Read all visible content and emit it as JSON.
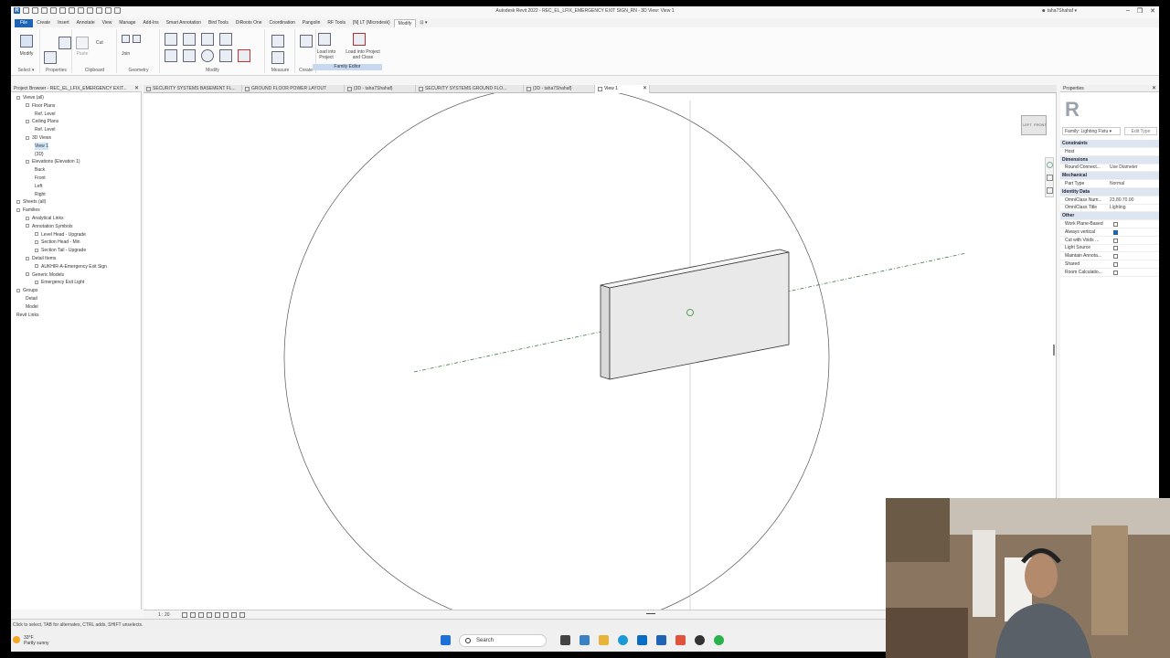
{
  "app": {
    "window_title": "Autodesk Revit 2022 - REC_EL_LFIX_EMERGENCY EXIT SIGN_RN - 3D View: View 1",
    "user": "taha7Shahaf",
    "quick_access_logo": "R"
  },
  "menu": {
    "tabs": [
      "File",
      "Create",
      "Insert",
      "Annotate",
      "View",
      "Manage",
      "Add-Ins",
      "Smart Annotation",
      "Bird Tools",
      "DiRoots One",
      "Coordination",
      "Pangolin",
      "RF Tools",
      "[N] LT (Microdesk)",
      "Modify",
      "⊡ ▾"
    ],
    "active": "Modify"
  },
  "ribbon": {
    "modify_label": "Modify",
    "select_label": "Select ▾",
    "properties_label": "Properties",
    "clipboard": {
      "label": "Clipboard",
      "paste": "Paste",
      "cut": "Cut",
      "join": "Join"
    },
    "geometry_label": "Geometry",
    "modify_group_label": "Modify",
    "measure_label": "Measure",
    "create_label": "Create",
    "load_into_project": "Load into Project",
    "load_into_project_close": "Load into Project and Close",
    "family_editor_label": "Family Editor"
  },
  "project_browser": {
    "title": "Project Browser - REC_EL_LFIX_EMERGENCY EXIT...",
    "items": [
      {
        "label": "Views (all)",
        "indent": 0,
        "toggle": true
      },
      {
        "label": "Floor Plans",
        "indent": 1,
        "toggle": true
      },
      {
        "label": "Ref. Level",
        "indent": 2,
        "toggle": false
      },
      {
        "label": "Ceiling Plans",
        "indent": 1,
        "toggle": true
      },
      {
        "label": "Ref. Level",
        "indent": 2,
        "toggle": false
      },
      {
        "label": "3D Views",
        "indent": 1,
        "toggle": true
      },
      {
        "label": "View 1",
        "indent": 2,
        "toggle": false,
        "selected": true
      },
      {
        "label": "{3D}",
        "indent": 2,
        "toggle": false
      },
      {
        "label": "Elevations (Elevation 1)",
        "indent": 1,
        "toggle": true
      },
      {
        "label": "Back",
        "indent": 2,
        "toggle": false
      },
      {
        "label": "Front",
        "indent": 2,
        "toggle": false
      },
      {
        "label": "Left",
        "indent": 2,
        "toggle": false
      },
      {
        "label": "Right",
        "indent": 2,
        "toggle": false
      },
      {
        "label": "Sheets (all)",
        "indent": 0,
        "toggle": true
      },
      {
        "label": "Families",
        "indent": 0,
        "toggle": true
      },
      {
        "label": "Analytical Links",
        "indent": 1,
        "toggle": true
      },
      {
        "label": "Annotation Symbols",
        "indent": 1,
        "toggle": true
      },
      {
        "label": "Level Head - Upgrade",
        "indent": 2,
        "toggle": true
      },
      {
        "label": "Section Head - Min",
        "indent": 2,
        "toggle": true
      },
      {
        "label": "Section Tail - Upgrade",
        "indent": 2,
        "toggle": true
      },
      {
        "label": "Detail Items",
        "indent": 1,
        "toggle": true
      },
      {
        "label": "AUKHIR-A-Emergency Exit Sign",
        "indent": 2,
        "toggle": true
      },
      {
        "label": "Generic Models",
        "indent": 1,
        "toggle": true
      },
      {
        "label": "Emergency Exit Light",
        "indent": 2,
        "toggle": true
      },
      {
        "label": "Groups",
        "indent": 0,
        "toggle": true
      },
      {
        "label": "Detail",
        "indent": 1,
        "toggle": false
      },
      {
        "label": "Model",
        "indent": 1,
        "toggle": false
      },
      {
        "label": "Revit Links",
        "indent": 0,
        "toggle": false
      }
    ]
  },
  "doc_tabs": [
    {
      "label": "SECURITY SYSTEMS BASEMENT FL..."
    },
    {
      "label": "GROUND FLOOR POWER LAYOUT"
    },
    {
      "label": "{3D - taha7Shahaf}"
    },
    {
      "label": "SECURITY SYSTEMS GROUND FLO..."
    },
    {
      "label": "{3D - taha7Shahaf}"
    },
    {
      "label": "View 1",
      "active": true
    }
  ],
  "viewcube": {
    "left": "LEFT",
    "front": "FRONT"
  },
  "view_control_bar": {
    "scale": "1 : 20"
  },
  "properties": {
    "title": "Properties",
    "family_selector": "Family: Lighting Fixtu ▾",
    "edit_type": "Edit Type",
    "rows": [
      {
        "section": "Constraints"
      },
      {
        "key": "Host",
        "value": ""
      },
      {
        "section": "Dimensions"
      },
      {
        "key": "Round Connect...",
        "value": "Use Diameter"
      },
      {
        "section": "Mechanical"
      },
      {
        "key": "Part Type",
        "value": "Normal"
      },
      {
        "section": "Identity Data"
      },
      {
        "key": "OmniClass Num...",
        "value": "23.80.70.00"
      },
      {
        "key": "OmniClass Title",
        "value": "Lighting"
      },
      {
        "section": "Other"
      },
      {
        "key": "Work Plane-Based",
        "check": false
      },
      {
        "key": "Always vertical",
        "check": true
      },
      {
        "key": "Cut with Voids ...",
        "check": false
      },
      {
        "key": "Light Source",
        "check": false
      },
      {
        "key": "Maintain Annota...",
        "check": false
      },
      {
        "key": "Shared",
        "check": false
      },
      {
        "key": "Room Calculatio...",
        "check": false
      }
    ]
  },
  "status": {
    "message": "Click to select, TAB for alternates, CTRL adds, SHIFT unselects."
  },
  "taskbar": {
    "weather_temp": "33°F",
    "weather_desc": "Partly sunny",
    "search_label": "Search"
  }
}
